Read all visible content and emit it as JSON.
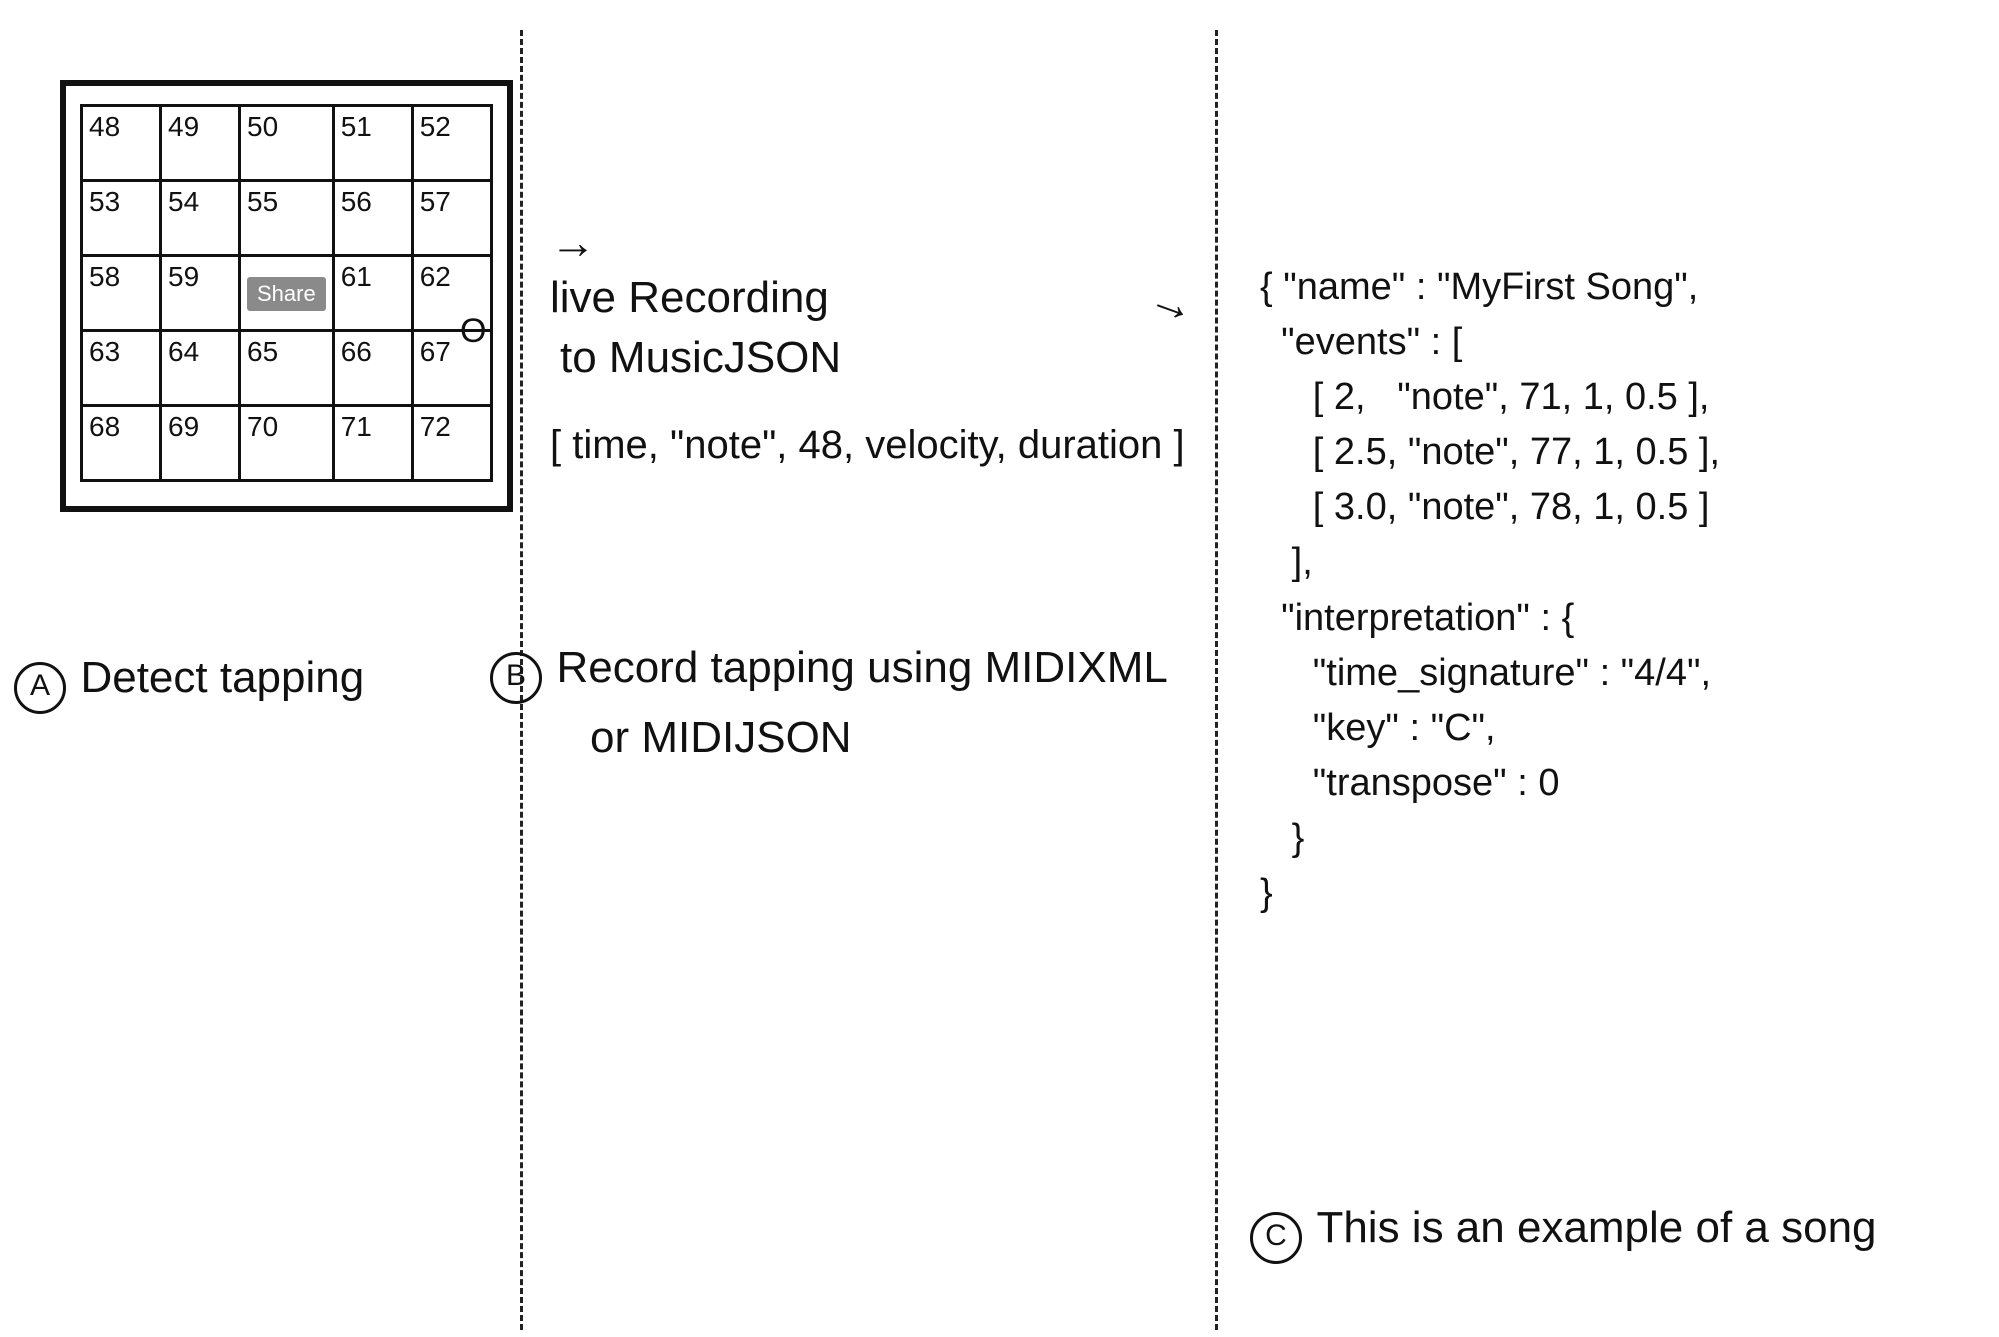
{
  "panelA": {
    "label_letter": "A",
    "caption": "Detect tapping",
    "share_button": "Share",
    "output_marker": "O",
    "grid": {
      "rows": [
        [
          "48",
          "49",
          "50",
          "51",
          "52"
        ],
        [
          "53",
          "54",
          "55",
          "56",
          "57"
        ],
        [
          "58",
          "59",
          "",
          "61",
          "62"
        ],
        [
          "63",
          "64",
          "65",
          "66",
          "67"
        ],
        [
          "68",
          "69",
          "70",
          "71",
          "72"
        ]
      ]
    }
  },
  "panelB": {
    "label_letter": "B",
    "arrow": "→",
    "line1": "live Recording",
    "line2": "to MusicJSON",
    "event_template": "[ time, \"note\", 48, velocity, duration ]",
    "caption_line1": "Record tapping using MIDIXML",
    "caption_line2": "or MIDIJSON"
  },
  "panelC": {
    "label_letter": "C",
    "arrow": "→",
    "caption": "This is an example of a song",
    "json_text": "{ \"name\" : \"MyFirst Song\",\n  \"events\" : [\n     [ 2,   \"note\", 71, 1, 0.5 ],\n     [ 2.5, \"note\", 77, 1, 0.5 ],\n     [ 3.0, \"note\", 78, 1, 0.5 ]\n   ],\n  \"interpretation\" : {\n     \"time_signature\" : \"4/4\",\n     \"key\" : \"C\",\n     \"transpose\" : 0\n   }\n}",
    "song": {
      "name": "MyFirst Song",
      "events": [
        [
          2,
          "note",
          71,
          1,
          0.5
        ],
        [
          2.5,
          "note",
          77,
          1,
          0.5
        ],
        [
          3.0,
          "note",
          78,
          1,
          0.5
        ]
      ],
      "interpretation": {
        "time_signature": "4/4",
        "key": "C",
        "transpose": 0
      }
    }
  }
}
